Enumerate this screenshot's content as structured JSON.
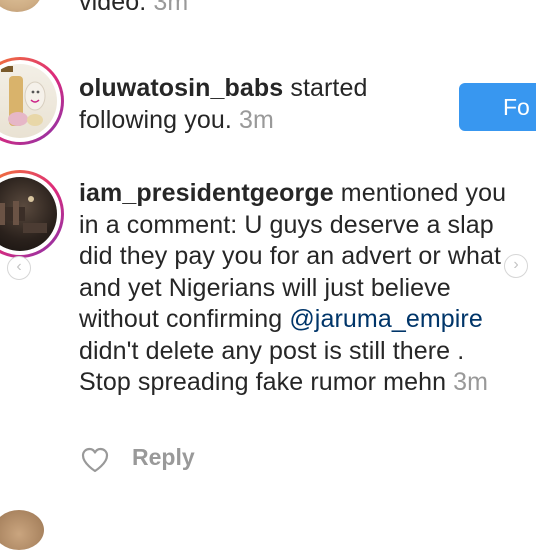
{
  "notifications": [
    {
      "partial_text": "video.",
      "time": "3m"
    },
    {
      "username": "oluwatosin_babs",
      "action": " started following you.",
      "time": "3m",
      "follow_label": "Fo"
    },
    {
      "username": "iam_presidentgeorge",
      "action_before_mention": " mentioned you in a comment: U guys deserve a slap did they pay you for an advert or what and yet Nigerians will just believe without confirming ",
      "mention": "@jaruma_empire",
      "action_after_mention": " didn't delete any post is still there . Stop spreading fake rumor mehn",
      "time": "3m",
      "reply_label": "Reply"
    }
  ],
  "colors": {
    "follow_button": "#3897f0",
    "time_text": "#999999",
    "mention_text": "#003569",
    "username_text": "#262626"
  },
  "icons": {
    "like": "heart-icon",
    "prev": "chevron-left-icon",
    "next": "chevron-right-icon"
  }
}
